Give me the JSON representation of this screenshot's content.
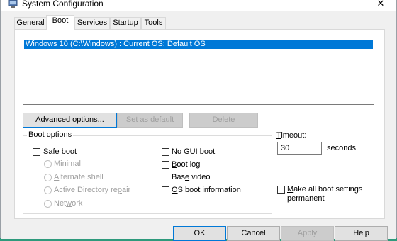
{
  "window": {
    "title": "System Configuration",
    "close_glyph": "✕",
    "icon": "msconfig-icon"
  },
  "tabs": [
    {
      "label": "General",
      "active": false
    },
    {
      "label": "Boot",
      "active": true
    },
    {
      "label": "Services",
      "active": false
    },
    {
      "label": "Startup",
      "active": false
    },
    {
      "label": "Tools",
      "active": false
    }
  ],
  "boot_list": {
    "items": [
      "Windows 10 (C:\\Windows) : Current OS; Default OS"
    ],
    "selected_index": 0
  },
  "list_buttons": {
    "advanced_pre": "Ad",
    "advanced_u": "v",
    "advanced_post": "anced options...",
    "set_default_pre": "",
    "set_default_u": "S",
    "set_default_post": "et as default",
    "delete_pre": "",
    "delete_u": "D",
    "delete_post": "elete"
  },
  "boot_options": {
    "legend": "Boot options",
    "safe_boot_pre": "S",
    "safe_boot_u": "a",
    "safe_boot_post": "fe boot",
    "minimal_u": "M",
    "minimal_post": "inimal",
    "alt_shell_u": "A",
    "alt_shell_post": "lternate shell",
    "ad_repair_pre": "Active Directory re",
    "ad_repair_u": "p",
    "ad_repair_post": "air",
    "network_pre": "Net",
    "network_u": "w",
    "network_post": "ork",
    "no_gui_u": "N",
    "no_gui_post": "o GUI boot",
    "boot_log_u": "B",
    "boot_log_post": "oot log",
    "base_video_pre": "Bas",
    "base_video_u": "e",
    "base_video_post": " video",
    "os_info_u": "O",
    "os_info_post": "S boot information"
  },
  "timeout": {
    "label_u": "T",
    "label_post": "imeout:",
    "value": "30",
    "unit": "seconds"
  },
  "make_permanent": {
    "line1_pre": "",
    "line1_u": "M",
    "line1_post": "ake all boot settings",
    "line2": "permanent"
  },
  "dialog_buttons": {
    "ok": "OK",
    "cancel": "Cancel",
    "apply": "Apply",
    "help": "Help"
  }
}
